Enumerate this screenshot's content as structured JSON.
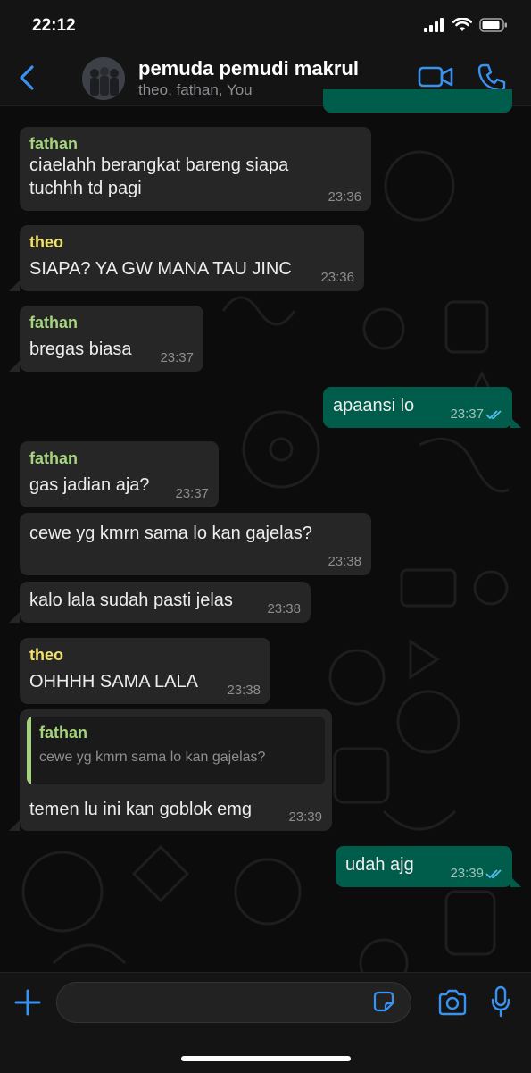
{
  "status_bar": {
    "time": "22:12"
  },
  "header": {
    "title": "pemuda pemudi makrul",
    "members": "theo, fathan, You"
  },
  "messages": [
    {
      "sender": "fathan",
      "text": "ciaelahh berangkat bareng siapa tuchhh td pagi",
      "time": "23:36"
    },
    {
      "sender": "theo",
      "text": "SIAPA? YA GW MANA TAU JINC",
      "time": "23:36"
    },
    {
      "sender": "fathan",
      "text": "bregas biasa",
      "time": "23:37"
    },
    {
      "sender": "You",
      "text": "apaansi lo",
      "time": "23:37"
    },
    {
      "sender": "fathan",
      "text": "gas jadian aja?",
      "time": "23:37"
    },
    {
      "sender": "",
      "text": "cewe yg kmrn sama lo kan gajelas?",
      "time": "23:38"
    },
    {
      "sender": "",
      "text": "kalo lala sudah pasti jelas",
      "time": "23:38"
    },
    {
      "sender": "theo",
      "text": "OHHHH SAMA LALA",
      "time": "23:38"
    },
    {
      "sender": "",
      "text": "temen lu ini kan goblok emg",
      "time": "23:39",
      "quote": {
        "sender": "fathan",
        "text": "cewe yg kmrn sama lo kan gajelas?"
      }
    },
    {
      "sender": "You",
      "text": "udah ajg",
      "time": "23:39"
    }
  ],
  "input": {
    "placeholder": ""
  },
  "colors": {
    "accent": "#3a92f0",
    "outgoing_bubble": "#005c4b",
    "incoming_bubble": "#262626",
    "fathan_name": "#a5d37e",
    "theo_name": "#f1e168"
  },
  "icons": [
    "back-icon",
    "video-call-icon",
    "phone-call-icon",
    "plus-icon",
    "sticker-icon",
    "camera-icon",
    "microphone-icon",
    "double-check-icon",
    "signal-icon",
    "wifi-icon",
    "battery-icon"
  ]
}
